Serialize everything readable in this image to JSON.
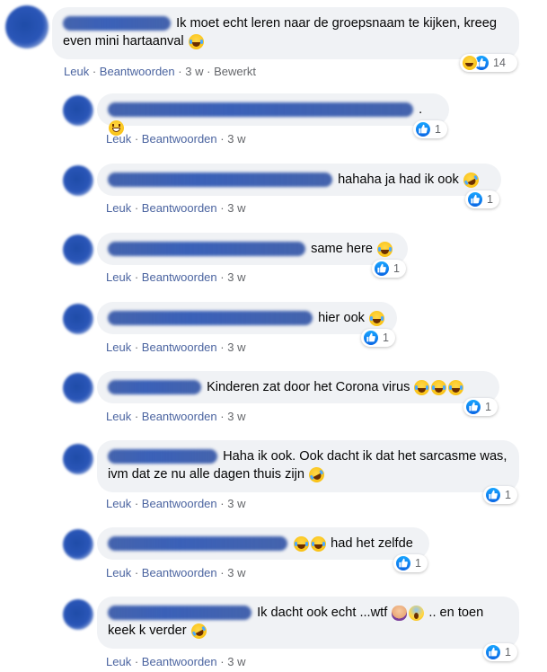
{
  "actions": {
    "like": "Leuk",
    "reply": "Beantwoorden",
    "dot": "·",
    "edited": "Bewerkt"
  },
  "accent_color": "#4b64a0",
  "like_color": "#1877f2",
  "comments": [
    {
      "text": "Ik moet echt leren naar de groepsnaam te kijken, kreeg even mini hartaanval",
      "emojis": [
        "laugh-emoji"
      ],
      "time": "3 w",
      "edited": true,
      "reactions": [
        "haha",
        "like"
      ],
      "count": "14"
    },
    {
      "text": ".",
      "emojis": [
        "grin-emoji"
      ],
      "time": "3 w",
      "edited": false,
      "reactions": [
        "like"
      ],
      "count": "1"
    },
    {
      "text": "hahaha ja had ik ook",
      "emojis": [
        "rofl-emoji"
      ],
      "time": "3 w",
      "edited": false,
      "reactions": [
        "like"
      ],
      "count": "1"
    },
    {
      "text": "same here",
      "emojis": [
        "laugh-emoji"
      ],
      "time": "3 w",
      "edited": false,
      "reactions": [
        "like"
      ],
      "count": "1"
    },
    {
      "text": "hier ook",
      "emojis": [
        "laugh-emoji"
      ],
      "time": "3 w",
      "edited": false,
      "reactions": [
        "like"
      ],
      "count": "1"
    },
    {
      "text": "Kinderen zat door het Corona virus",
      "emojis": [
        "laugh-emoji",
        "laugh-emoji",
        "laugh-emoji"
      ],
      "time": "3 w",
      "edited": false,
      "reactions": [
        "like"
      ],
      "count": "1"
    },
    {
      "text": "Haha ik ook. Ook dacht ik dat het sarcasme was, ivm dat ze nu alle dagen thuis zijn",
      "emojis": [
        "rofl-emoji"
      ],
      "time": "3 w",
      "edited": false,
      "reactions": [
        "like"
      ],
      "count": "1"
    },
    {
      "text": "had het zelfde",
      "emojis": [
        "laugh-emoji",
        "laugh-emoji"
      ],
      "time": "3 w",
      "edited": false,
      "reactions": [
        "like"
      ],
      "count": "1"
    },
    {
      "text_a": "Ik dacht ook echt ...wtf",
      "text_b": ".. en toen keek k verder",
      "emojis": [
        "facepalm-emoji",
        "scream-emoji",
        "rofl-emoji"
      ],
      "time": "3 w",
      "edited": false,
      "reactions": [
        "like"
      ],
      "count": "1"
    }
  ]
}
